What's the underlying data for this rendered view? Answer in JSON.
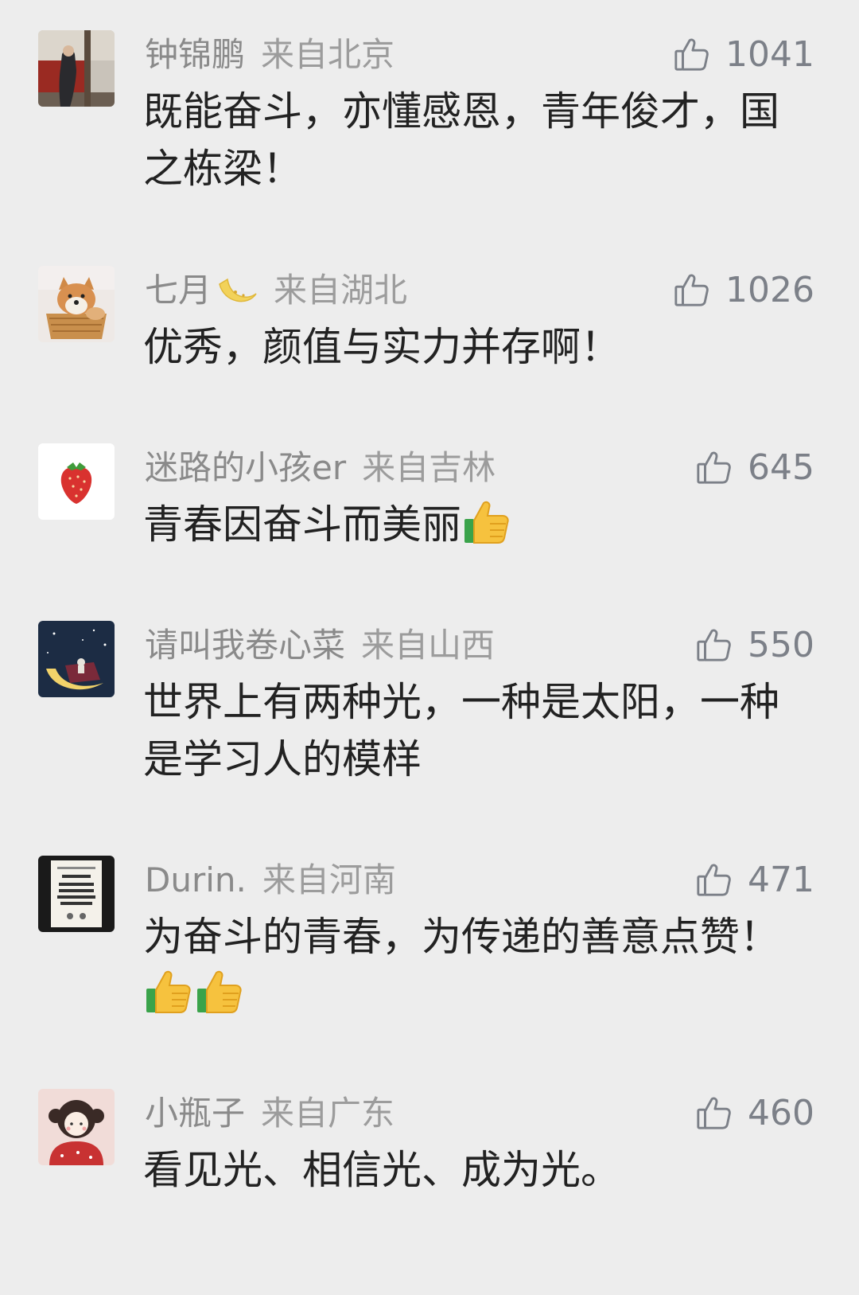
{
  "comments": [
    {
      "user": "钟锦鹏",
      "location": "来自北京",
      "likes": "1041",
      "text": "既能奋斗，亦懂感恩，青年俊才，国之栋梁！",
      "avatar_icon": "portrait-photo-icon"
    },
    {
      "user": "七月",
      "location": "来自湖北",
      "likes": "1026",
      "text": "优秀，颜值与实力并存啊！",
      "avatar_icon": "shiba-dog-photo-icon",
      "name_emoji": "moon-emoji-icon"
    },
    {
      "user": "迷路的小孩er",
      "location": "来自吉林",
      "likes": "645",
      "text": "青春因奋斗而美丽",
      "avatar_icon": "strawberry-icon",
      "text_emoji": "thumbs-up-emoji-icon"
    },
    {
      "user": "请叫我卷心菜",
      "location": "来自山西",
      "likes": "550",
      "text": "世界上有两种光，一种是太阳，一种是学习人的模样",
      "avatar_icon": "night-moon-illustration-icon"
    },
    {
      "user": "Durin.",
      "location": "来自河南",
      "likes": "471",
      "text": "为奋斗的青春，为传递的善意点赞！",
      "avatar_icon": "poster-icon",
      "text_emoji_count": 2
    },
    {
      "user": "小瓶子",
      "location": "来自广东",
      "likes": "460",
      "text": "看见光、相信光、成为光。",
      "avatar_icon": "cartoon-girl-icon"
    }
  ],
  "colors": {
    "background": "#ededed",
    "username": "#8a8a8a",
    "text": "#222222",
    "like": "#7c8088"
  }
}
